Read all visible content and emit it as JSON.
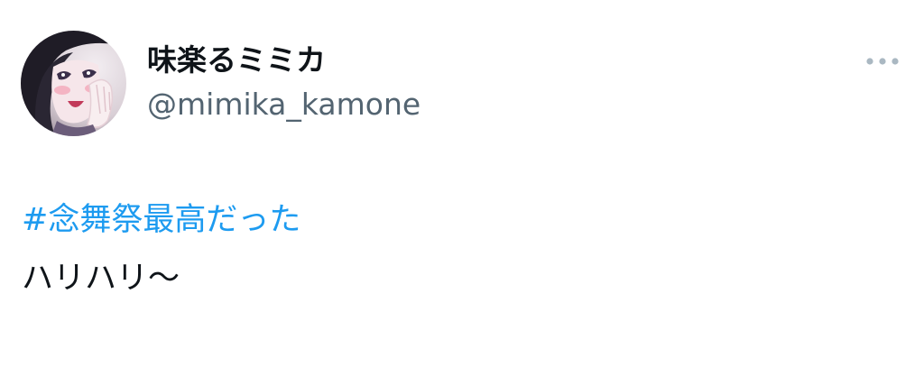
{
  "author": {
    "display_name": "味楽るミミカ",
    "handle": "@mimika_kamone",
    "avatar_icon": "avatar-icon"
  },
  "more_icon": "more-horizontal-icon",
  "tweet": {
    "hashtag": "#念舞祭最高だった",
    "text": "ハリハリ〜"
  },
  "colors": {
    "hashtag_blue": "#1d9bf0",
    "handle_gray": "#536471",
    "text_black": "#0f1419",
    "more_dots": "#aab8c2"
  }
}
